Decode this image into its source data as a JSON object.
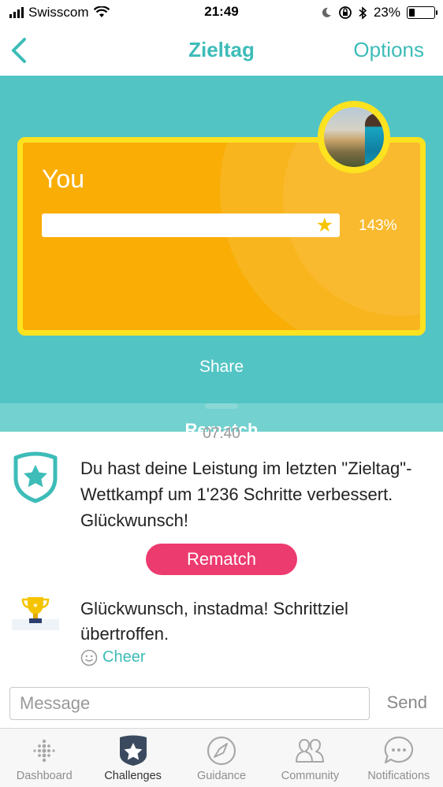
{
  "status_bar": {
    "carrier": "Swisscom",
    "time": "21:49",
    "battery_percent": "23%",
    "battery_level": 0.23
  },
  "nav": {
    "back_icon": "chevron-left-icon",
    "title": "Zieltag",
    "options_label": "Options"
  },
  "challenge_card": {
    "participant_label": "You",
    "progress_percent_text": "143%",
    "progress_value": 1.43,
    "progress_star_icon": "star-icon"
  },
  "actions": {
    "share_label": "Share",
    "rematch_label": "Rematch"
  },
  "feed": {
    "clipped_time": "07:40",
    "items": [
      {
        "icon": "shield-star-icon",
        "text": "Du hast deine Leistung im letzten \"Zieltag\"-Wettkampf um 1'236 Schritte verbessert. Glückwunsch!",
        "button_label": "Rematch"
      },
      {
        "icon": "trophy-icon",
        "text": "Glückwunsch, instadma! Schrittziel übertroffen.",
        "cheer_label": "Cheer"
      }
    ]
  },
  "composer": {
    "placeholder": "Message",
    "value": "",
    "send_label": "Send"
  },
  "tabs": [
    {
      "label": "Dashboard",
      "icon": "dots-grid-icon",
      "active": false
    },
    {
      "label": "Challenges",
      "icon": "star-badge-icon",
      "active": true
    },
    {
      "label": "Guidance",
      "icon": "compass-icon",
      "active": false
    },
    {
      "label": "Community",
      "icon": "people-icon",
      "active": false
    },
    {
      "label": "Notifications",
      "icon": "speech-bubble-icon",
      "active": false
    }
  ],
  "colors": {
    "accent_teal": "#3dbcb8",
    "panel_teal": "#53c4c4",
    "card_orange": "#f9ad05",
    "card_border": "#fde21f",
    "rematch_pink": "#ec3b6f"
  }
}
